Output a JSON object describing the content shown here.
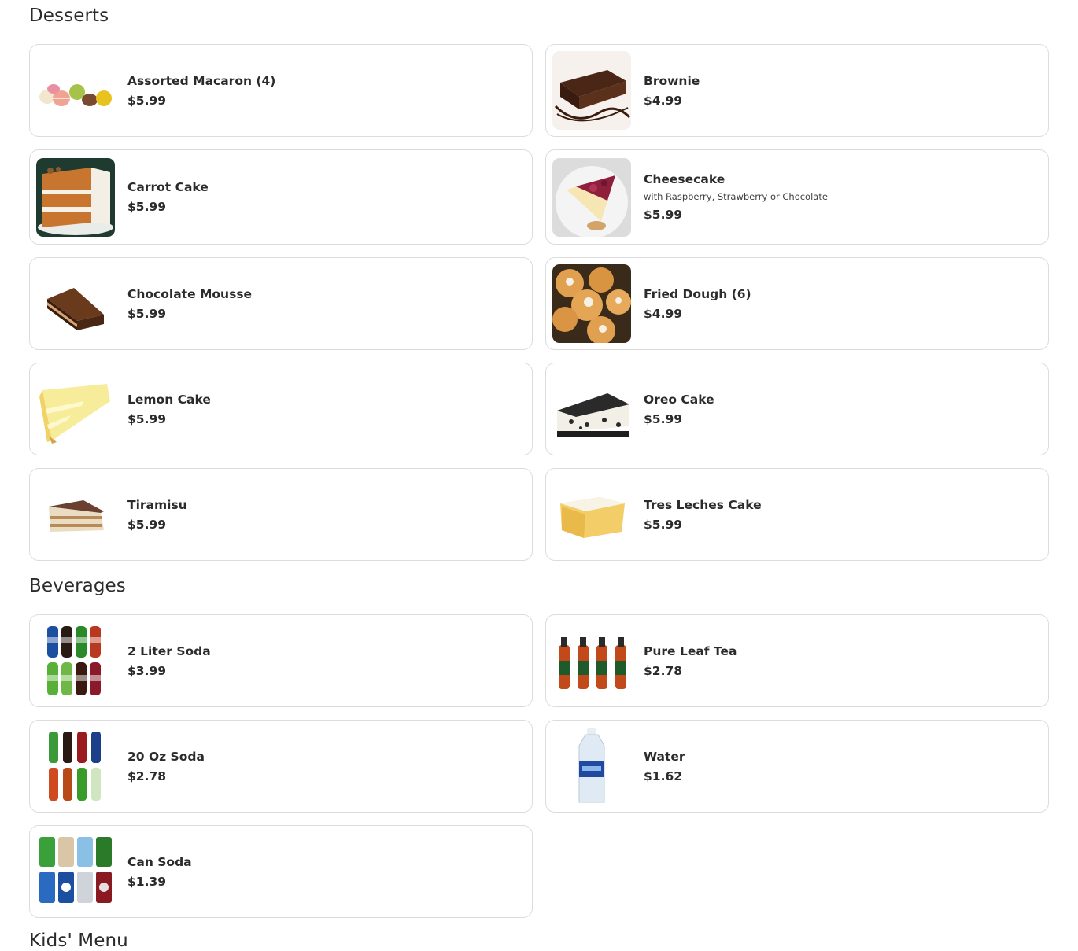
{
  "sections": {
    "desserts": {
      "title": "Desserts",
      "items": [
        {
          "name": "Assorted Macaron (4)",
          "price": "$5.99",
          "icon": "macaron-image"
        },
        {
          "name": "Brownie",
          "price": "$4.99",
          "icon": "brownie-image"
        },
        {
          "name": "Carrot Cake",
          "price": "$5.99",
          "icon": "carrot-cake-image"
        },
        {
          "name": "Cheesecake",
          "description": "with Raspberry, Strawberry or Chocolate",
          "price": "$5.99",
          "icon": "cheesecake-image"
        },
        {
          "name": "Chocolate Mousse",
          "price": "$5.99",
          "icon": "chocolate-mousse-image"
        },
        {
          "name": "Fried Dough (6)",
          "price": "$4.99",
          "icon": "fried-dough-image"
        },
        {
          "name": "Lemon Cake",
          "price": "$5.99",
          "icon": "lemon-cake-image"
        },
        {
          "name": "Oreo Cake",
          "price": "$5.99",
          "icon": "oreo-cake-image"
        },
        {
          "name": "Tiramisu",
          "price": "$5.99",
          "icon": "tiramisu-image"
        },
        {
          "name": "Tres Leches Cake",
          "price": "$5.99",
          "icon": "tres-leches-image"
        }
      ]
    },
    "beverages": {
      "title": "Beverages",
      "items": [
        {
          "name": "2 Liter Soda",
          "price": "$3.99",
          "icon": "two-liter-soda-image"
        },
        {
          "name": "Pure Leaf Tea",
          "price": "$2.78",
          "icon": "pure-leaf-tea-image"
        },
        {
          "name": "20 Oz Soda",
          "price": "$2.78",
          "icon": "twenty-oz-soda-image"
        },
        {
          "name": "Water",
          "price": "$1.62",
          "icon": "water-bottle-image"
        },
        {
          "name": "Can Soda",
          "price": "$1.39",
          "icon": "can-soda-image"
        }
      ]
    },
    "kids": {
      "title": "Kids' Menu"
    }
  },
  "colors": {
    "card_border": "#dcdcdc",
    "text": "#2b2b2b"
  }
}
